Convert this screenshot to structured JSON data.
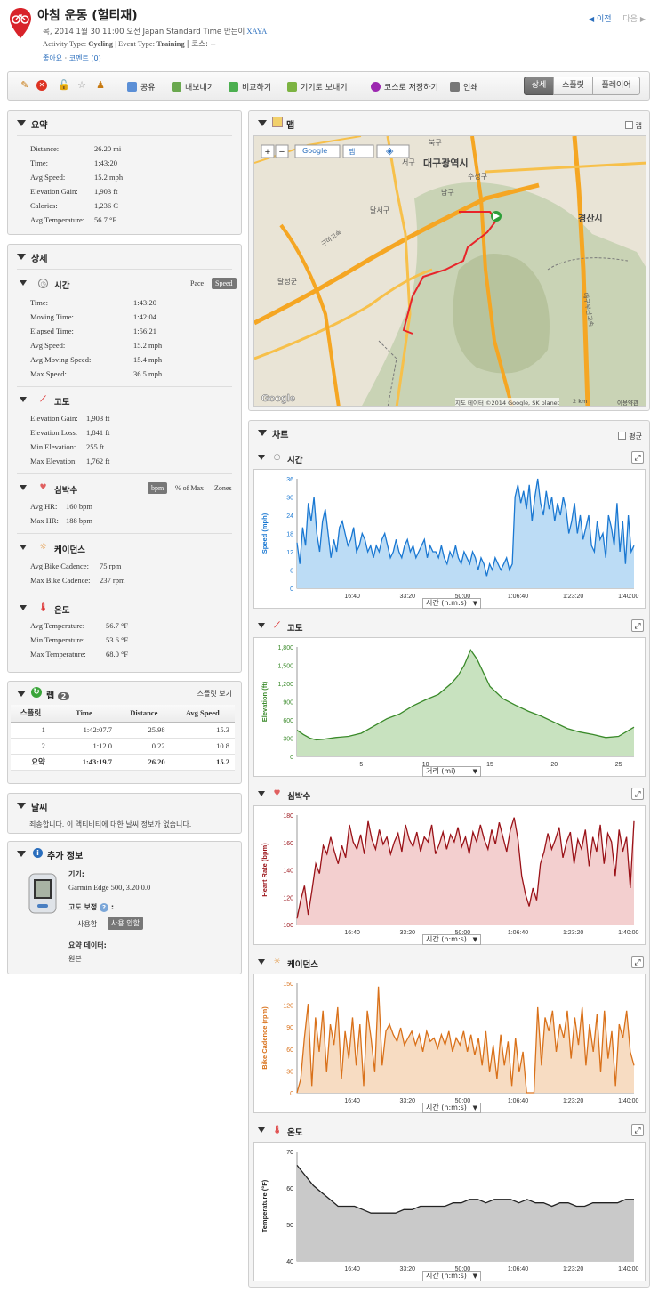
{
  "header": {
    "title": "아침 운동 (헐티재)",
    "date_prefix": "목, 2014 1월 30 11:00 오전 Japan Standard Time 만든이",
    "author": "XAYA",
    "activity_type_label": "Activity Type:",
    "activity_type": "Cycling",
    "event_type_label": "| Event Type:",
    "event_type": "Training",
    "course_label": "| 코스: --",
    "like": "좋아요",
    "dot": "·",
    "comments": "코멘트 (0)",
    "prev": "이전",
    "next": "다음"
  },
  "toolbar": {
    "share": "공유",
    "export": "내보내기",
    "compare": "비교하기",
    "send_to_device": "기기로 보내기",
    "save_as_course": "코스로 저장하기",
    "print": "인쇄",
    "views": [
      "상세",
      "스플릿",
      "플레이어"
    ]
  },
  "summary": {
    "title": "요약",
    "rows": [
      {
        "label": "Distance:",
        "value": "26.20 mi"
      },
      {
        "label": "Time:",
        "value": "1:43:20"
      },
      {
        "label": "Avg Speed:",
        "value": "15.2 mph"
      },
      {
        "label": "Elevation Gain:",
        "value": "1,903 ft"
      },
      {
        "label": "Calories:",
        "value": "1,236 C"
      },
      {
        "label": "Avg Temperature:",
        "value": "56.7 °F"
      }
    ]
  },
  "details": {
    "title": "상세",
    "time": {
      "title": "시간",
      "toggle": [
        "Pace",
        "Speed"
      ],
      "rows": [
        {
          "label": "Time:",
          "value": "1:43:20"
        },
        {
          "label": "Moving Time:",
          "value": "1:42:04"
        },
        {
          "label": "Elapsed Time:",
          "value": "1:56:21"
        },
        {
          "label": "Avg Speed:",
          "value": "15.2 mph"
        },
        {
          "label": "Avg Moving Speed:",
          "value": "15.4 mph"
        },
        {
          "label": "Max Speed:",
          "value": "36.5 mph"
        }
      ]
    },
    "elevation": {
      "title": "고도",
      "rows": [
        {
          "label": "Elevation Gain:",
          "value": "1,903 ft"
        },
        {
          "label": "Elevation Loss:",
          "value": "1,841 ft"
        },
        {
          "label": "Min Elevation:",
          "value": "255 ft"
        },
        {
          "label": "Max Elevation:",
          "value": "1,762 ft"
        }
      ]
    },
    "heart_rate": {
      "title": "심박수",
      "toggle": [
        "bpm",
        "% of Max",
        "Zones"
      ],
      "rows": [
        {
          "label": "Avg HR:",
          "value": "160 bpm"
        },
        {
          "label": "Max HR:",
          "value": "188 bpm"
        }
      ]
    },
    "cadence": {
      "title": "케이던스",
      "rows": [
        {
          "label": "Avg Bike Cadence:",
          "value": "75 rpm"
        },
        {
          "label": "Max Bike Cadence:",
          "value": "237 rpm"
        }
      ]
    },
    "temperature": {
      "title": "온도",
      "rows": [
        {
          "label": "Avg Temperature:",
          "value": "56.7 °F"
        },
        {
          "label": "Min Temperature:",
          "value": "53.6 °F"
        },
        {
          "label": "Max Temperature:",
          "value": "68.0 °F"
        }
      ]
    }
  },
  "laps": {
    "title": "랩",
    "count": "2",
    "split_view": "스플릿 보기",
    "headers": [
      "스플릿",
      "Time",
      "Distance",
      "Avg Speed"
    ],
    "rows": [
      [
        "1",
        "1:42:07.7",
        "25.98",
        "15.3"
      ],
      [
        "2",
        "1:12.0",
        "0.22",
        "10.8"
      ]
    ],
    "total": [
      "요약",
      "1:43:19.7",
      "26.20",
      "15.2"
    ]
  },
  "weather": {
    "title": "날씨",
    "message": "죄송합니다. 이 액티비티에 대한 날씨 정보가 없습니다."
  },
  "extra": {
    "title": "추가 정보",
    "device_label": "기기:",
    "device": "Garmin Edge 500, 3.20.0.0",
    "elev_corr_label": "고도 보정",
    "elev_corr_suffix": ":",
    "use": "사용함",
    "no_use": "사용 안함",
    "summary_data_label": "요약 데이터:",
    "summary_data": "원본"
  },
  "map": {
    "title": "맵",
    "checkbox_label": "랩",
    "provider": "Google",
    "map_type": "맵",
    "attribution": "지도 데이터 ©2014 Google, SK planet",
    "scale": "2 km",
    "terms": "이용약관",
    "labels": [
      "대구광역시",
      "경산시",
      "수성구",
      "달서구",
      "남구",
      "북구",
      "서구",
      "달성군",
      "구마고속",
      "대구부산고속"
    ]
  },
  "charts": {
    "title": "차트",
    "avg_label": "평균",
    "x_time": "시간 (h:m:s)",
    "x_dist": "거리 (mi)"
  },
  "chart_data": [
    {
      "type": "area",
      "title": "시간",
      "ylabel": "Speed (mph)",
      "xlabel": "시간 (h:m:s)",
      "ylim": [
        0,
        36
      ],
      "yticks": [
        "0",
        "6",
        "12",
        "18",
        "24",
        "30",
        "36"
      ],
      "xticks": [
        "16:40",
        "33:20",
        "50:00",
        "1:06:40",
        "1:23:20",
        "1:40:00"
      ],
      "color": "#1a78d2",
      "fill": "#bcdcf5",
      "values": [
        15,
        8,
        20,
        14,
        28,
        22,
        30,
        18,
        12,
        22,
        26,
        18,
        10,
        16,
        12,
        20,
        22,
        18,
        14,
        16,
        20,
        12,
        14,
        18,
        16,
        12,
        14,
        10,
        14,
        12,
        16,
        18,
        14,
        10,
        12,
        16,
        12,
        10,
        14,
        16,
        12,
        14,
        10,
        12,
        14,
        16,
        10,
        14,
        12,
        12,
        10,
        14,
        10,
        8,
        12,
        10,
        14,
        10,
        8,
        12,
        10,
        8,
        12,
        10,
        6,
        10,
        8,
        4,
        8,
        6,
        10,
        8,
        6,
        8,
        10,
        6,
        8,
        30,
        34,
        28,
        32,
        26,
        34,
        22,
        30,
        36,
        28,
        24,
        32,
        26,
        30,
        22,
        28,
        24,
        30,
        26,
        18,
        22,
        28,
        18,
        24,
        16,
        20,
        24,
        14,
        12,
        22,
        16,
        18,
        10,
        24,
        20,
        14,
        28,
        12,
        22,
        8,
        24,
        12,
        14
      ]
    },
    {
      "type": "area",
      "title": "고도",
      "ylabel": "Elevation (ft)",
      "xlabel": "거리 (mi)",
      "ylim": [
        0,
        1800
      ],
      "yticks": [
        "0",
        "300",
        "600",
        "900",
        "1,200",
        "1,500",
        "1,800"
      ],
      "xticks": [
        "5",
        "10",
        "15",
        "20",
        "25"
      ],
      "color": "#3a8a2a",
      "fill": "#c8e2bf",
      "x": [
        0,
        0.5,
        1,
        1.5,
        2,
        3,
        4,
        5,
        6,
        7,
        8,
        9,
        10,
        11,
        12,
        12.5,
        13,
        13.5,
        14,
        15,
        16,
        17,
        18,
        19,
        20,
        21,
        22,
        23,
        24,
        25,
        26.2
      ],
      "values": [
        430,
        360,
        300,
        270,
        280,
        310,
        330,
        380,
        500,
        620,
        700,
        830,
        930,
        1020,
        1200,
        1320,
        1500,
        1750,
        1600,
        1150,
        950,
        840,
        740,
        660,
        560,
        460,
        400,
        360,
        310,
        330,
        480
      ]
    },
    {
      "type": "area",
      "title": "심박수",
      "ylabel": "Heart Rate (bpm)",
      "xlabel": "시간 (h:m:s)",
      "ylim": [
        100,
        190
      ],
      "yticks": [
        "100",
        "120",
        "140",
        "160",
        "180"
      ],
      "xticks": [
        "16:40",
        "33:20",
        "50:00",
        "1:06:40",
        "1:23:20",
        "1:40:00"
      ],
      "color": "#9a1218",
      "fill": "#f3cfcf",
      "values": [
        105,
        120,
        132,
        108,
        128,
        150,
        142,
        165,
        158,
        172,
        160,
        150,
        165,
        155,
        182,
        168,
        162,
        174,
        158,
        185,
        170,
        162,
        178,
        166,
        172,
        158,
        168,
        175,
        160,
        182,
        170,
        164,
        176,
        160,
        172,
        168,
        182,
        158,
        166,
        176,
        162,
        174,
        168,
        180,
        164,
        172,
        158,
        176,
        168,
        182,
        170,
        162,
        178,
        166,
        184,
        172,
        160,
        178,
        188,
        170,
        140,
        125,
        115,
        130,
        120,
        150,
        160,
        175,
        162,
        170,
        180,
        155,
        168,
        176,
        150,
        170,
        162,
        178,
        148,
        172,
        160,
        182,
        150,
        175,
        168,
        140,
        178,
        160,
        172,
        130,
        185
      ]
    },
    {
      "type": "area",
      "title": "케이던스",
      "ylabel": "Bike Cadence (rpm)",
      "xlabel": "시간 (h:m:s)",
      "ylim": [
        0,
        160
      ],
      "yticks": [
        "0",
        "30",
        "60",
        "90",
        "120",
        "150"
      ],
      "xticks": [
        "16:40",
        "33:20",
        "50:00",
        "1:06:40",
        "1:23:20",
        "1:40:00"
      ],
      "color": "#d9711a",
      "fill": "#f7dcc2",
      "values": [
        0,
        20,
        80,
        130,
        10,
        110,
        60,
        120,
        30,
        100,
        70,
        125,
        20,
        90,
        50,
        110,
        40,
        100,
        10,
        120,
        80,
        30,
        155,
        40,
        90,
        100,
        85,
        75,
        95,
        70,
        80,
        90,
        70,
        85,
        60,
        90,
        75,
        80,
        65,
        85,
        70,
        90,
        60,
        80,
        70,
        90,
        60,
        85,
        55,
        80,
        40,
        90,
        30,
        70,
        20,
        85,
        40,
        75,
        10,
        80,
        30,
        60,
        0,
        0,
        0,
        125,
        40,
        110,
        90,
        120,
        60,
        100,
        80,
        120,
        50,
        110,
        70,
        125,
        40,
        100,
        60,
        115,
        30,
        120,
        50,
        90,
        10,
        100,
        80,
        120,
        60,
        40
      ]
    },
    {
      "type": "area",
      "title": "온도",
      "ylabel": "Temperature (°F)",
      "xlabel": "시간 (h:m:s)",
      "ylim": [
        40,
        72
      ],
      "yticks": [
        "40",
        "50",
        "60",
        "70"
      ],
      "xticks": [
        "16:40",
        "33:20",
        "50:00",
        "1:06:40",
        "1:23:20",
        "1:40:00"
      ],
      "color": "#222222",
      "fill": "#c9c9c9",
      "values": [
        68,
        65,
        62,
        60,
        58,
        56,
        56,
        56,
        55,
        54,
        54,
        54,
        54,
        55,
        55,
        56,
        56,
        56,
        56,
        57,
        57,
        58,
        58,
        57,
        58,
        58,
        58,
        57,
        58,
        57,
        57,
        56,
        57,
        57,
        56,
        56,
        57,
        57,
        57,
        57,
        58,
        58
      ]
    }
  ]
}
